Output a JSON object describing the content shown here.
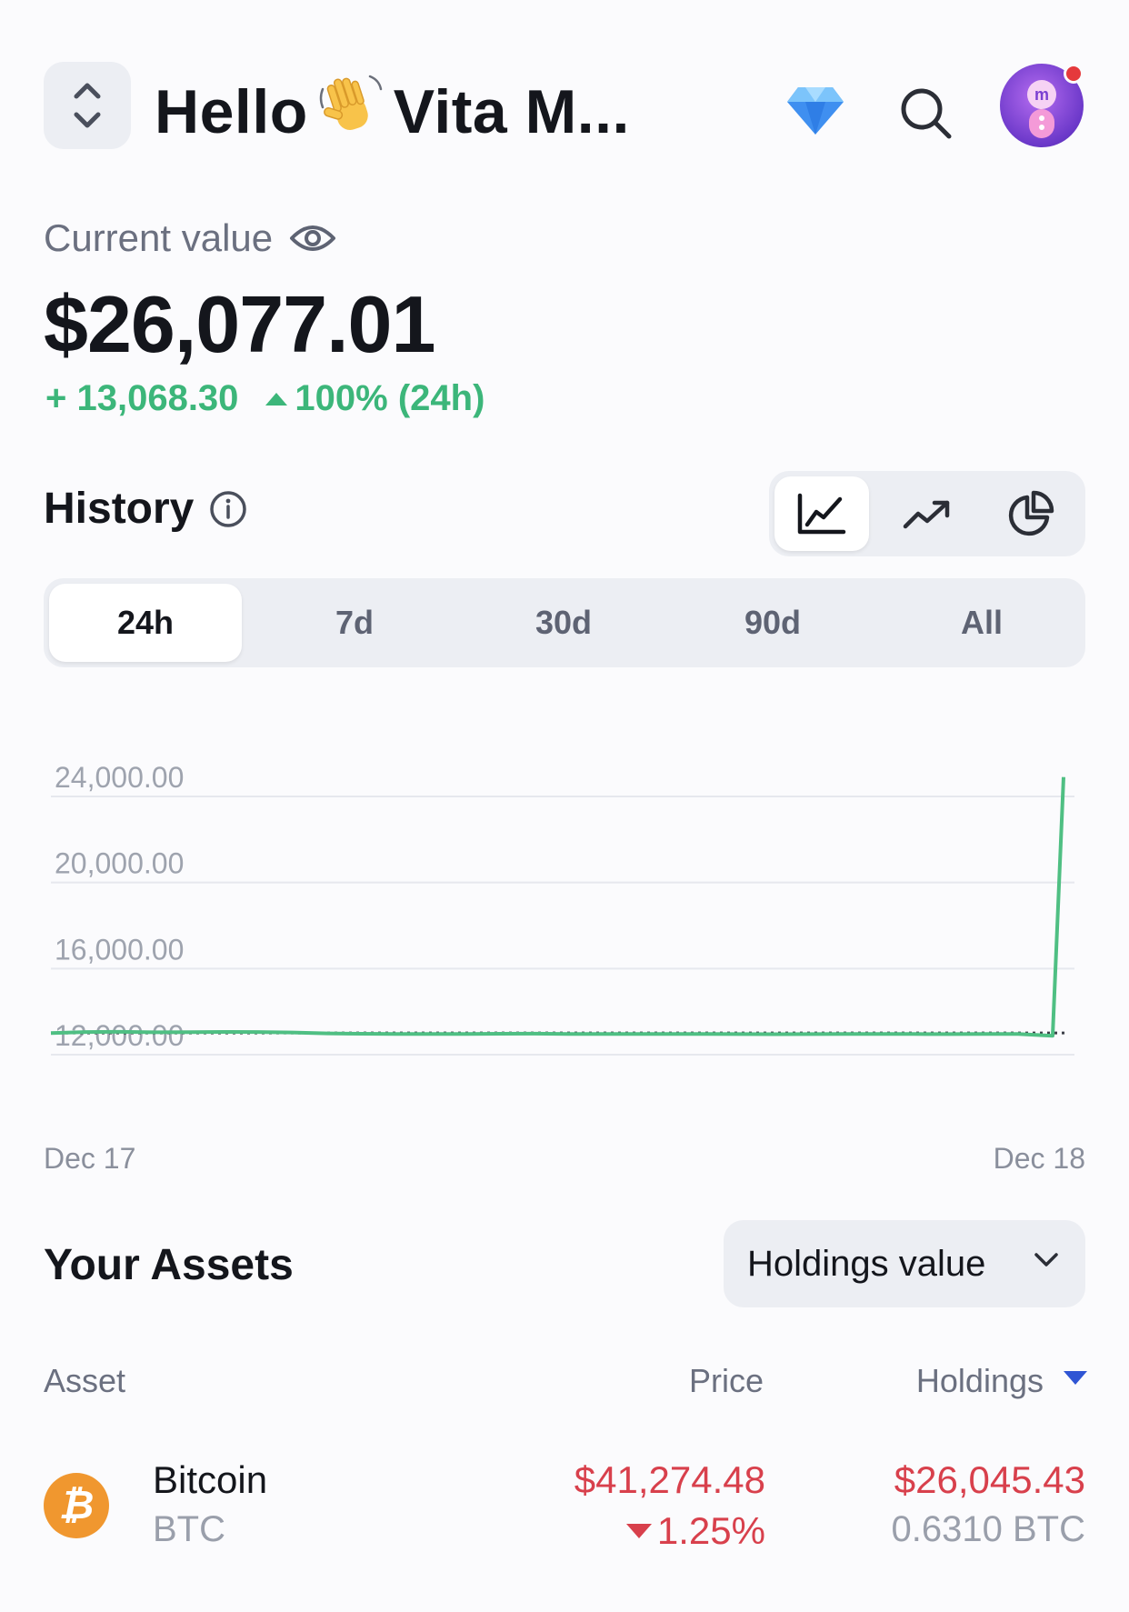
{
  "header": {
    "hello": "Hello",
    "wave_icon": "waving-hand-icon",
    "user_name": "Vita M...",
    "icons": [
      "diamond-icon",
      "search-icon",
      "avatar"
    ]
  },
  "summary": {
    "label": "Current value",
    "value": "$26,077.01",
    "change_abs": "+ 13,068.30",
    "change_pct": "100% (24h)",
    "positive_color": "#3cb67a"
  },
  "history": {
    "title": "History",
    "chart_types": [
      "line-chart-icon",
      "trend-up-icon",
      "pie-chart-icon"
    ],
    "active_chart_type": "line-chart-icon",
    "ranges": [
      "24h",
      "7d",
      "30d",
      "90d",
      "All"
    ],
    "active_range": "24h"
  },
  "chart_data": {
    "type": "line",
    "x_start_label": "Dec 17",
    "x_end_label": "Dec 18",
    "ytick_labels": [
      "24,000.00",
      "20,000.00",
      "16,000.00",
      "12,000.00"
    ],
    "ylim": [
      12000,
      25000
    ],
    "baseline": 13008.71,
    "line_color": "#4fbf83",
    "series": [
      {
        "values": [
          13000,
          13050,
          13060,
          13040,
          13045,
          13055,
          13050,
          13030,
          12990,
          12970,
          12960,
          12965,
          12960,
          12970,
          12975,
          12965,
          12960,
          12958,
          12962,
          12960,
          12955,
          12950,
          12955,
          12960,
          12965,
          12960,
          12955,
          12958,
          12960,
          12880,
          24900
        ]
      }
    ]
  },
  "assets": {
    "title": "Your Assets",
    "sort_dropdown": "Holdings value",
    "columns": {
      "asset": "Asset",
      "price": "Price",
      "holdings": "Holdings"
    },
    "rows": [
      {
        "icon": "bitcoin-icon",
        "logo_glyph": "₿",
        "name": "Bitcoin",
        "symbol": "BTC",
        "price": "$41,274.48",
        "price_change": "1.25%",
        "holding_value": "$26,045.43",
        "holding_qty": "0.6310 BTC",
        "negative_color": "#d8404c"
      }
    ]
  }
}
